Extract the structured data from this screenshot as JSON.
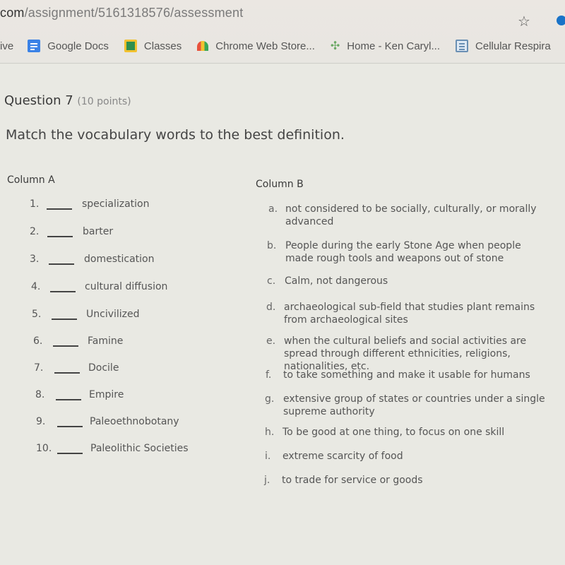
{
  "browser": {
    "url_host": "com",
    "url_path": "/assignment/5161318576/assessment",
    "star_icon": "star-outline-icon",
    "bookmarks": [
      {
        "label": "ive",
        "icon": ""
      },
      {
        "label": "Google Docs",
        "icon": "google-docs-icon"
      },
      {
        "label": "Classes",
        "icon": "google-classroom-icon"
      },
      {
        "label": "Chrome Web Store...",
        "icon": "chrome-web-store-icon"
      },
      {
        "label": "Home - Ken Caryl...",
        "icon": "tree-icon"
      },
      {
        "label": "Cellular Respira",
        "icon": "document-icon"
      }
    ]
  },
  "question": {
    "title": "Question 7",
    "points": "(10 points)",
    "prompt": "Match the vocabulary words to the best definition."
  },
  "column_a": {
    "title": "Column A",
    "items": [
      {
        "num": "1.",
        "term": "specialization",
        "answer": ""
      },
      {
        "num": "2.",
        "term": "barter",
        "answer": ""
      },
      {
        "num": "3.",
        "term": "domestication",
        "answer": ""
      },
      {
        "num": "4.",
        "term": "cultural diffusion",
        "answer": ""
      },
      {
        "num": "5.",
        "term": "Uncivilized",
        "answer": ""
      },
      {
        "num": "6.",
        "term": "Famine",
        "answer": ""
      },
      {
        "num": "7.",
        "term": "Docile",
        "answer": ""
      },
      {
        "num": "8.",
        "term": "Empire",
        "answer": ""
      },
      {
        "num": "9.",
        "term": "Paleoethnobotany",
        "answer": ""
      },
      {
        "num": "10.",
        "term": "Paleolithic Societies",
        "answer": ""
      }
    ]
  },
  "column_b": {
    "title": "Column B",
    "items": [
      {
        "letter": "a.",
        "definition": "not considered to be socially, culturally, or morally advanced"
      },
      {
        "letter": "b.",
        "definition": "People during the early Stone Age when people made rough tools and weapons out of stone"
      },
      {
        "letter": "c.",
        "definition": "Calm, not dangerous"
      },
      {
        "letter": "d.",
        "definition": "archaeological sub-field that studies plant remains from archaeological sites"
      },
      {
        "letter": "e.",
        "definition": "when the cultural beliefs and social activities are spread through different ethnicities, religions, nationalities, etc."
      },
      {
        "letter": "f.",
        "definition": "to take something and make it usable for humans"
      },
      {
        "letter": "g.",
        "definition": "extensive group of states or countries under a single supreme authority"
      },
      {
        "letter": "h.",
        "definition": "To be good at one thing, to focus on one skill"
      },
      {
        "letter": "i.",
        "definition": "extreme scarcity of food"
      },
      {
        "letter": "j.",
        "definition": "to trade for service or goods"
      }
    ]
  }
}
